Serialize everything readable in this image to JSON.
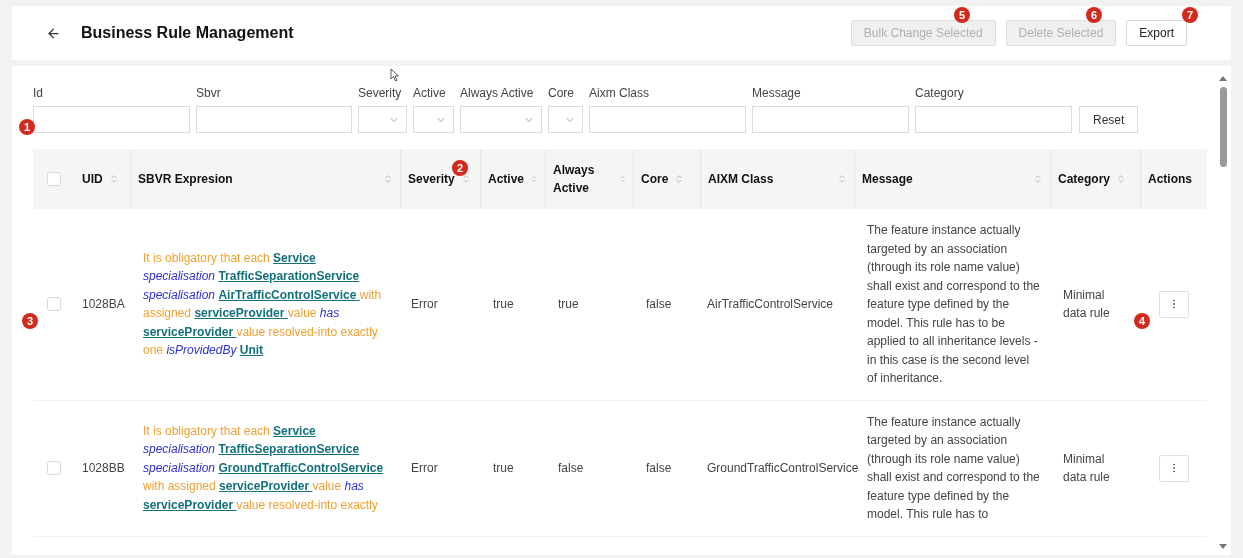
{
  "header": {
    "title": "Business Rule Management",
    "buttons": [
      {
        "label": "Bulk Change Selected",
        "disabled": true
      },
      {
        "label": "Delete Selected",
        "disabled": true
      },
      {
        "label": "Export",
        "disabled": false
      }
    ]
  },
  "filters": [
    {
      "label": "Id",
      "kind": "text"
    },
    {
      "label": "Sbvr",
      "kind": "text"
    },
    {
      "label": "Severity",
      "kind": "select"
    },
    {
      "label": "Active",
      "kind": "select"
    },
    {
      "label": "Always Active",
      "kind": "select"
    },
    {
      "label": "Core",
      "kind": "select"
    },
    {
      "label": "Aixm Class",
      "kind": "text"
    },
    {
      "label": "Message",
      "kind": "text"
    },
    {
      "label": "Category",
      "kind": "text"
    }
  ],
  "reset_button": "Reset",
  "table": {
    "select_all_checked": false,
    "columns": [
      {
        "label": "UID",
        "sortable": true
      },
      {
        "label": "SBVR Expresion",
        "sortable": true
      },
      {
        "label": "Severity",
        "sortable": true
      },
      {
        "label": "Active",
        "sortable": true
      },
      {
        "label": "Always Active",
        "sortable": true
      },
      {
        "label": "Core",
        "sortable": true
      },
      {
        "label": "AIXM Class",
        "sortable": true
      },
      {
        "label": "Message",
        "sortable": true
      },
      {
        "label": "Category",
        "sortable": true
      },
      {
        "label": "Actions",
        "sortable": false
      }
    ],
    "rows": [
      {
        "selected": false,
        "uid": "1028BA",
        "sbvr": [
          {
            "kind": "plain",
            "text": "It is obligatory that each"
          },
          {
            "kind": "term",
            "text": "Service"
          },
          {
            "kind": "keyword",
            "text": "specialisation"
          },
          {
            "kind": "term",
            "text": "TrafficSeparationService"
          },
          {
            "kind": "keyword",
            "text": "specialisation"
          },
          {
            "kind": "term",
            "text": "AirTrafficControlService"
          },
          {
            "kind": "plain",
            "text": "with assigned"
          },
          {
            "kind": "term",
            "text": "serviceProvider"
          },
          {
            "kind": "plain",
            "text": "value"
          },
          {
            "kind": "keyword",
            "text": "has"
          },
          {
            "kind": "term",
            "text": "serviceProvider"
          },
          {
            "kind": "plain",
            "text": "value resolved-into exactly one"
          },
          {
            "kind": "keyword",
            "text": "isProvidedBy"
          },
          {
            "kind": "term",
            "text": "Unit"
          }
        ],
        "severity": "Error",
        "active": "true",
        "always_active": "true",
        "core": "false",
        "aixm_class": "AirTrafficControlService",
        "message": "The feature instance actually targeted by an association (through its role name value) shall exist and correspond to the feature type defined by the model. This rule has to be applied to all inheritance levels - in this case is the second level of inheritance.",
        "category": "Minimal data rule"
      },
      {
        "selected": false,
        "uid": "1028BB",
        "sbvr": [
          {
            "kind": "plain",
            "text": "It is obligatory that each"
          },
          {
            "kind": "term",
            "text": "Service"
          },
          {
            "kind": "keyword",
            "text": "specialisation"
          },
          {
            "kind": "term",
            "text": "TrafficSeparationService"
          },
          {
            "kind": "keyword",
            "text": "specialisation"
          },
          {
            "kind": "term",
            "text": "GroundTrafficControlService"
          },
          {
            "kind": "plain",
            "text": "with assigned"
          },
          {
            "kind": "term",
            "text": "serviceProvider"
          },
          {
            "kind": "plain",
            "text": "value"
          },
          {
            "kind": "keyword",
            "text": "has"
          },
          {
            "kind": "term",
            "text": "serviceProvider"
          },
          {
            "kind": "plain",
            "text": "value resolved-into exactly"
          }
        ],
        "severity": "Error",
        "active": "true",
        "always_active": "false",
        "core": "false",
        "aixm_class": "GroundTrafficControlService",
        "message": "The feature instance actually targeted by an association (through its role name value) shall exist and correspond to the feature type defined by the model. This rule has to",
        "category": "Minimal data rule"
      }
    ]
  },
  "callouts": [
    "1",
    "2",
    "3",
    "4",
    "5",
    "6",
    "7"
  ]
}
